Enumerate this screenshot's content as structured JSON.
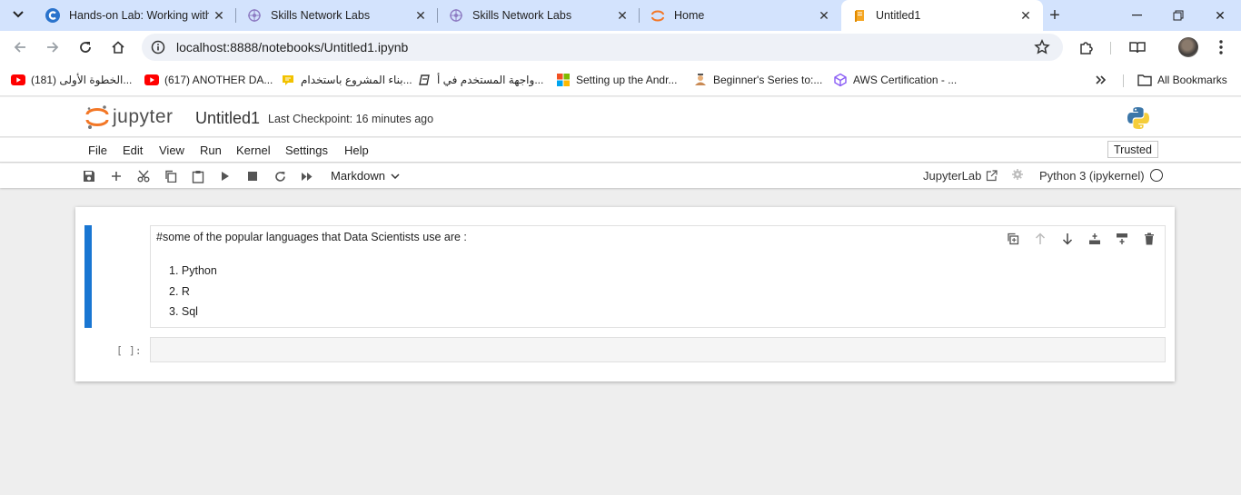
{
  "browser": {
    "tabs": [
      {
        "title": "Hands-on Lab: Working with",
        "favicon": "coursera-icon"
      },
      {
        "title": "Skills Network Labs",
        "favicon": "skills-network-icon"
      },
      {
        "title": "Skills Network Labs",
        "favicon": "skills-network-icon"
      },
      {
        "title": "Home",
        "favicon": "jupyter-icon"
      },
      {
        "title": "Untitled1",
        "favicon": "notebook-icon",
        "active": true
      }
    ],
    "url": "localhost:8888/notebooks/Untitled1.ipynb",
    "bookmarks": [
      {
        "label": "(181) الخطوة الأولى...",
        "icon": "youtube-icon"
      },
      {
        "label": "(617) ANOTHER DA...",
        "icon": "youtube-icon"
      },
      {
        "label": "بناء المشروع باستخدام...",
        "icon": "chat-icon"
      },
      {
        "label": "واجهة المستخدم في أ...",
        "icon": "edge-icon"
      },
      {
        "label": "Setting up the Andr...",
        "icon": "microsoft-icon"
      },
      {
        "label": "Beginner's Series to:...",
        "icon": "learn-icon"
      },
      {
        "label": "AWS Certification - ...",
        "icon": "aws-cube-icon"
      }
    ],
    "all_bookmarks": "All Bookmarks",
    "colors": {
      "tabstrip": "#d3e3fd",
      "accent": "#1976d2"
    }
  },
  "jupyter": {
    "logo_text": "jupyter",
    "notebook_title": "Untitled1",
    "checkpoint": "Last Checkpoint: 16 minutes ago",
    "menu": [
      "File",
      "Edit",
      "View",
      "Run",
      "Kernel",
      "Settings",
      "Help"
    ],
    "trusted": "Trusted",
    "cell_type": "Markdown",
    "jupyterlab_link": "JupyterLab",
    "kernel": "Python 3 (ipykernel)"
  },
  "cells": {
    "markdown_heading": "#some of the popular languages that Data Scientists use are :",
    "markdown_list": [
      "1. Python",
      "2. R",
      "3. Sql"
    ],
    "code_prompt": "[ ]:"
  }
}
